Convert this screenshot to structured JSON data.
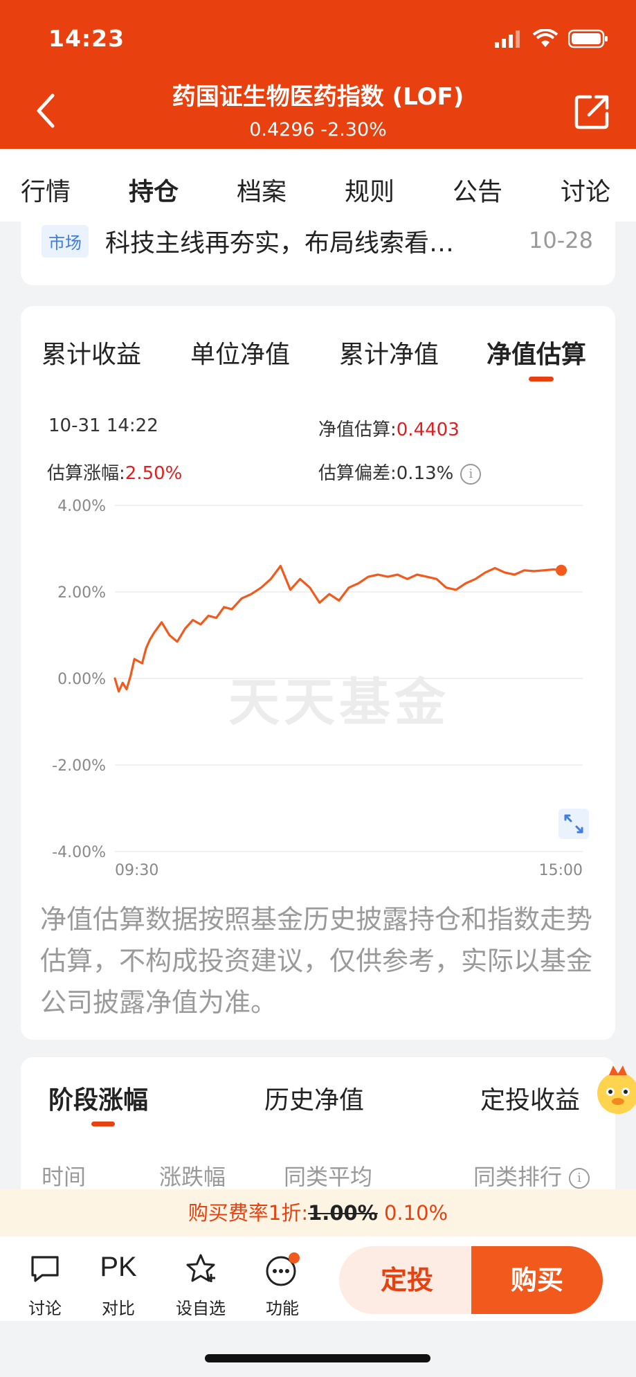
{
  "status_bar": {
    "time": "14:23"
  },
  "header": {
    "title": "药国证生物医药指数 (LOF)",
    "subtitle": "0.4296 -2.30%",
    "background": "#e8400e"
  },
  "tabs": [
    "行情",
    "持仓",
    "档案",
    "规则",
    "公告",
    "讨论"
  ],
  "active_tab": "持仓",
  "news": {
    "tag": "市场",
    "title": "科技主线再夯实，布局线索看…",
    "date": "10-28"
  },
  "chart_tabs": [
    "累计收益",
    "单位净值",
    "累计净值",
    "净值估算"
  ],
  "active_chart_tab": "净值估算",
  "estimate": {
    "datetime": "10-31 14:22",
    "nav_label": "净值估算:",
    "nav_value": "0.4403",
    "change_label": "估算涨幅:",
    "change_value": "2.50%",
    "deviation_label": "估算偏差:",
    "deviation_value": "0.13%"
  },
  "watermark": "天天基金",
  "chart_data": {
    "type": "line",
    "title": "",
    "xlabel": "",
    "ylabel": "",
    "y_ticks": [
      "4.00%",
      "2.00%",
      "0.00%",
      "-2.00%",
      "-4.00%"
    ],
    "ylim": [
      -4,
      4
    ],
    "x_ticks": [
      "09:30",
      "15:00"
    ],
    "grid": true,
    "line_color": "#f25a1d",
    "series": [
      {
        "x_minutes": [
          0,
          2,
          4,
          6,
          8,
          10,
          12,
          14,
          16,
          18,
          20,
          24,
          28,
          32,
          36,
          40,
          44,
          48,
          52,
          56,
          60,
          65,
          70,
          75,
          80,
          85,
          90,
          95,
          100,
          105,
          110,
          115,
          120,
          125,
          130,
          135,
          140,
          145,
          150,
          155,
          160,
          165,
          170,
          175,
          180,
          185,
          190,
          195,
          200,
          205,
          210,
          215,
          220,
          225,
          229
        ],
        "y": [
          0.0,
          -0.3,
          -0.1,
          -0.25,
          0.05,
          0.45,
          0.4,
          0.35,
          0.7,
          0.9,
          1.05,
          1.3,
          1.0,
          0.85,
          1.15,
          1.35,
          1.25,
          1.45,
          1.4,
          1.65,
          1.6,
          1.85,
          1.95,
          2.1,
          2.3,
          2.6,
          2.05,
          2.3,
          2.1,
          1.75,
          1.95,
          1.8,
          2.1,
          2.2,
          2.35,
          2.4,
          2.35,
          2.4,
          2.3,
          2.4,
          2.35,
          2.3,
          2.1,
          2.05,
          2.2,
          2.3,
          2.45,
          2.55,
          2.45,
          2.4,
          2.5,
          2.48,
          2.5,
          2.52,
          2.5
        ]
      }
    ]
  },
  "disclaimer": "净值估算数据按照基金历史披露持仓和指数走势估算，不构成投资建议，仅供参考，实际以基金公司披露净值为准。",
  "period_tabs": [
    "阶段涨幅",
    "历史净值",
    "定投收益"
  ],
  "active_period_tab": "阶段涨幅",
  "period_columns": [
    "时间",
    "涨跌幅",
    "同类平均",
    "同类排行"
  ],
  "fee": {
    "label": "购买费率1折:",
    "original": "1.00%",
    "discounted": "0.10%"
  },
  "bottom_bar": {
    "items": [
      "讨论",
      "对比",
      "设自选",
      "功能"
    ],
    "pk_text": "PK",
    "btn_invest": "定投",
    "btn_buy": "购买"
  }
}
